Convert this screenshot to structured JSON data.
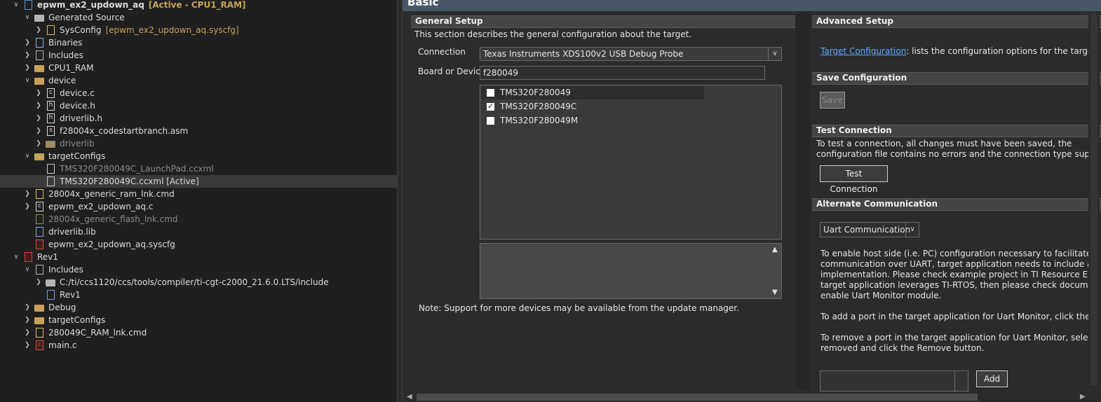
{
  "tree": {
    "rows": [
      {
        "label": "epwm_ex2_updown_aq",
        "suffix": "[Active - CPU1_RAM]",
        "chev": "down",
        "icon": "project-icon"
      },
      {
        "label": "Generated Source",
        "chev": "down",
        "icon": "folder-source-icon"
      },
      {
        "label": "SysConfig",
        "suffix": "[epwm_ex2_updown_aq.syscfg]",
        "chev": "right",
        "icon": "sysconfig-icon"
      },
      {
        "label": "Binaries",
        "chev": "right",
        "icon": "binaries-icon"
      },
      {
        "label": "Includes",
        "chev": "right",
        "icon": "includes-icon"
      },
      {
        "label": "CPU1_RAM",
        "chev": "right",
        "icon": "folder-icon"
      },
      {
        "label": "device",
        "chev": "down",
        "icon": "folder-open-icon"
      },
      {
        "label": "device.c",
        "chev": "right",
        "icon": "c-file-icon"
      },
      {
        "label": "device.h",
        "chev": "right",
        "icon": "h-file-icon"
      },
      {
        "label": "driverlib.h",
        "chev": "right",
        "icon": "h-file-icon"
      },
      {
        "label": "f28004x_codestartbranch.asm",
        "chev": "right",
        "icon": "asm-file-icon"
      },
      {
        "label": "driverlib",
        "chev": "right",
        "icon": "folder-excluded-icon"
      },
      {
        "label": "targetConfigs",
        "chev": "down",
        "icon": "folder-open-icon"
      },
      {
        "label": "TMS320F280049C_LaunchPad.ccxml",
        "icon": "ccxml-file-icon"
      },
      {
        "label": "TMS320F280049C.ccxml [Active]",
        "icon": "ccxml-file-icon"
      },
      {
        "label": "28004x_generic_ram_lnk.cmd",
        "chev": "right",
        "icon": "cmd-file-icon"
      },
      {
        "label": "epwm_ex2_updown_aq.c",
        "chev": "right",
        "icon": "c-file-icon"
      },
      {
        "label": "28004x_generic_flash_lnk.cmd",
        "icon": "cmd-file-excluded-icon"
      },
      {
        "label": "driverlib.lib",
        "icon": "lib-file-icon"
      },
      {
        "label": "epwm_ex2_updown_aq.syscfg",
        "icon": "syscfg-file-icon"
      },
      {
        "label": "Rev1",
        "chev": "down",
        "icon": "project-error-icon"
      },
      {
        "label": "Includes",
        "chev": "down",
        "icon": "includes-icon"
      },
      {
        "label": "C:/ti/ccs1120/ccs/tools/compiler/ti-cgt-c2000_21.6.0.LTS/include",
        "chev": "right",
        "icon": "include-folder-icon"
      },
      {
        "label": "Rev1",
        "icon": "workspace-include-icon"
      },
      {
        "label": "Debug",
        "chev": "right",
        "icon": "folder-icon"
      },
      {
        "label": "targetConfigs",
        "chev": "right",
        "icon": "folder-icon"
      },
      {
        "label": "280049C_RAM_lnk.cmd",
        "chev": "right",
        "icon": "cmd-file-icon"
      },
      {
        "label": "main.c",
        "chev": "right",
        "icon": "c-file-error-icon"
      }
    ]
  },
  "editor": {
    "header": "Basic",
    "general": {
      "title": "General Setup",
      "desc": "This section describes the general configuration about the target.",
      "connection_label": "Connection",
      "connection_value": "Texas Instruments XDS100v2 USB Debug Probe",
      "board_label": "Board or Device",
      "board_value": "f280049",
      "devices": [
        {
          "label": "TMS320F280049",
          "checked": false
        },
        {
          "label": "TMS320F280049C",
          "checked": true
        },
        {
          "label": "TMS320F280049M",
          "checked": false
        }
      ],
      "note": "Note: Support for more devices may be available from the update manager."
    },
    "advanced": {
      "title": "Advanced Setup",
      "link": "Target Configuration",
      "link_tail": ": lists the configuration options for the target."
    },
    "save": {
      "title": "Save Configuration",
      "button": "Save"
    },
    "test": {
      "title": "Test Connection",
      "line1": "To test a connection, all changes must have been saved, the",
      "line2": "configuration file contains no errors and the connection type supports this",
      "button": "Test Connection"
    },
    "alternate": {
      "title": "Alternate Communication",
      "combo": "Uart Communication",
      "p1": [
        "To enable host side (i.e. PC) configuration necessary to facilitate data",
        "communication over UART, target application needs to include a monitor",
        "implementation. Please check example project in TI Resource Explorer. If",
        "target application leverages TI-RTOS, then please check documentation on",
        "enable Uart Monitor module."
      ],
      "p2": "To add a port in the target application for Uart Monitor, click the Add butt",
      "p3": [
        "To remove a port in the target application for Uart Monitor, select the port",
        "removed and click the Remove button."
      ],
      "add_button": "Add"
    }
  }
}
